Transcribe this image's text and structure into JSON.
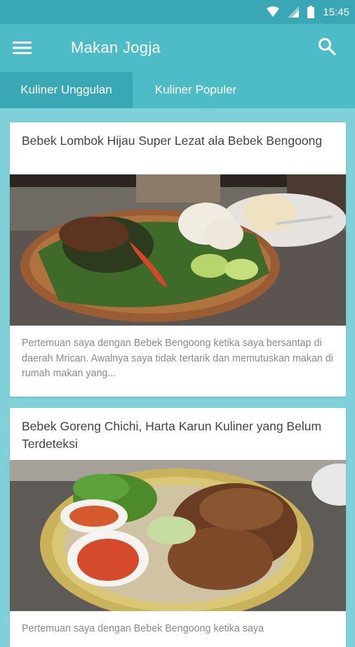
{
  "status_bar": {
    "time": "15:45",
    "icons": [
      "wifi-icon",
      "signal-icon",
      "battery-icon"
    ]
  },
  "app_bar": {
    "title": "Makan Jogja",
    "menu_icon": "menu-icon",
    "search_icon": "search-icon"
  },
  "tabs": [
    {
      "label": "Kuliner Unggulan",
      "selected": true
    },
    {
      "label": "Kuliner Populer",
      "selected": false
    }
  ],
  "articles": [
    {
      "title": "Bebek Lombok Hijau Super Lezat ala Bebek Bengoong",
      "excerpt": "Pertemuan saya dengan Bebek Bengoong ketika saya bersantap di daerah Mrican. Awalnya saya tidak tertarik dan memutuskan makan di rumah makan yang..."
    },
    {
      "title": "Bebek Goreng Chichi, Harta Karun Kuliner yang Belum Terdeteksi",
      "excerpt": "Pertemuan saya dengan Bebek Bengoong ketika saya"
    }
  ],
  "colors": {
    "status_bar": "#3aa8b4",
    "app_bar": "#4dbcc7",
    "selected_tab": "#3aa8b4",
    "background": "#7fd0d9"
  }
}
